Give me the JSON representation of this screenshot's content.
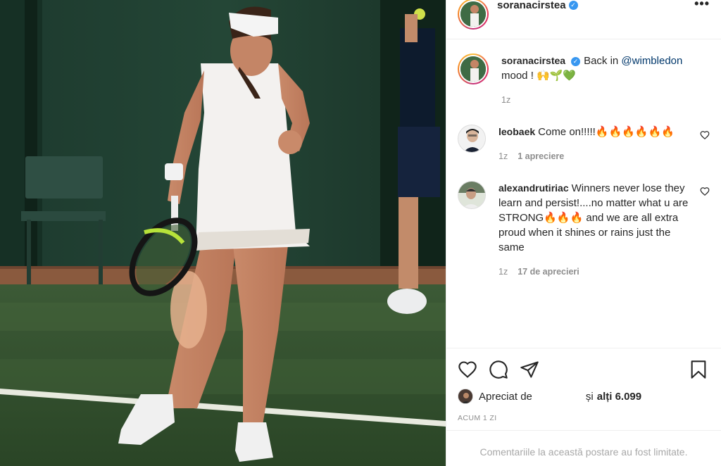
{
  "post": {
    "author": "soranacirstea",
    "verified_mark": "✓",
    "more_menu": "•••",
    "image_desc_icon": "post-photo"
  },
  "caption": {
    "author": "soranacirstea",
    "text_before": "Back in ",
    "mention": "@wimbledon",
    "text_after": " mood ! 🙌🌱💚",
    "time": "1z"
  },
  "comments": [
    {
      "author": "leobaek",
      "text": "Come on!!!!!🔥🔥🔥🔥🔥🔥",
      "time": "1z",
      "likes": "1 apreciere"
    },
    {
      "author": "alexandrutiriac",
      "text": "Winners never lose they learn and persist!....no matter what u are STRONG🔥🔥🔥 and we are all extra proud when it shines or rains just the same",
      "time": "1z",
      "likes": "17 de aprecieri"
    }
  ],
  "actions": {
    "like_icon": "heart-icon",
    "comment_icon": "comment-icon",
    "share_icon": "share-icon",
    "save_icon": "bookmark-icon"
  },
  "likes": {
    "prefix": "Apreciat de",
    "connector": "și",
    "others": "alți 6.099"
  },
  "posted_ago": "ACUM 1 ZI",
  "comments_limited": "Comentariile la această postare au fost limitate.",
  "colors": {
    "link": "#00376b",
    "verified": "#3897f0",
    "muted": "#8e8e8e",
    "text": "#262626"
  }
}
